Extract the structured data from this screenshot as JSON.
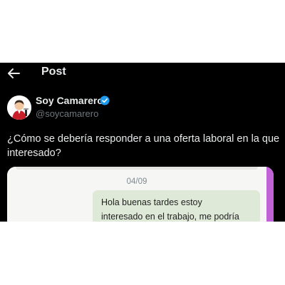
{
  "header": {
    "back_icon": "arrow-left-icon",
    "title": "Post"
  },
  "post": {
    "author": {
      "name": "Soy Camarero",
      "handle": "@soycamarero",
      "verified_icon": "verified-badge-icon",
      "verified_color": "#1d9bf0"
    },
    "text_lines": [
      "¿Cómo se debería responder a una oferta laboral en la que",
      "interesado?"
    ],
    "media": {
      "date": "04/09",
      "message_lines": [
        "Hola buenas tardes estoy",
        "interesado en el trabajo, me podría"
      ]
    }
  },
  "colors": {
    "background": "#000000",
    "text": "#e7e9ea",
    "secondary_text": "#71767b",
    "chat_bubble": "#dfe9d8",
    "media_accent": "#c063d6"
  }
}
